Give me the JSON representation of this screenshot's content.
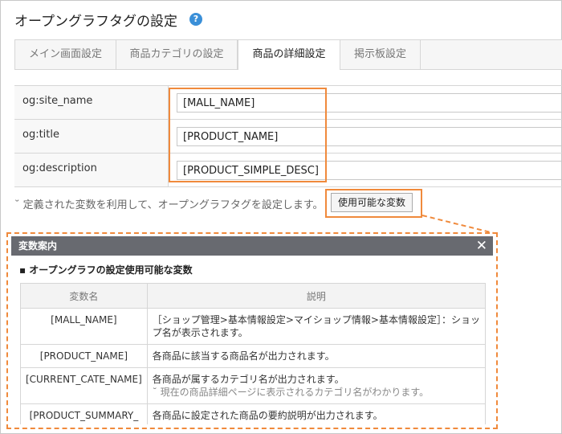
{
  "page": {
    "title": "オープングラフタグの設定",
    "help_icon": "question-icon",
    "help_glyph": "?"
  },
  "tabs": [
    {
      "label": "メイン画面設定"
    },
    {
      "label": "商品カテゴリの設定"
    },
    {
      "label": "商品の詳細設定",
      "active": true
    },
    {
      "label": "掲示板設定"
    }
  ],
  "fields": [
    {
      "label": "og:site_name",
      "value": "[MALL_NAME]"
    },
    {
      "label": "og:title",
      "value": "[PRODUCT_NAME]"
    },
    {
      "label": "og:description",
      "value": "[PRODUCT_SIMPLE_DESC]"
    }
  ],
  "note": "˘ 定義された変数を利用して、オープングラフタグを設定します。",
  "variables_button": "使用可能な変数",
  "popup": {
    "title": "変数案内",
    "close_glyph": "✕",
    "section": "▪ オープングラフの設定使用可能な変数",
    "columns": [
      "変数名",
      "説明"
    ],
    "rows": [
      {
        "name": "[MALL_NAME]",
        "desc": "［ショップ管理>基本情報設定>マイショップ情報>基本情報設定］：ショップ名が表示されます。",
        "sub": ""
      },
      {
        "name": "[PRODUCT_NAME]",
        "desc": "各商品に該当する商品名が出力されます。",
        "sub": ""
      },
      {
        "name": "[CURRENT_CATE_NAME]",
        "desc": "各商品が属するカテゴリ名が出力されます。",
        "sub": "˘ 現在の商品詳細ページに表示されるカテゴリ名がわかります。"
      },
      {
        "name": "[PRODUCT_SUMMARY_",
        "desc": "各商品に設定された商品の要約説明が出力されます。",
        "sub": ""
      }
    ]
  },
  "colors": {
    "highlight": "#f08a3c",
    "popup_header": "#686a70",
    "help": "#3a8fd8"
  }
}
